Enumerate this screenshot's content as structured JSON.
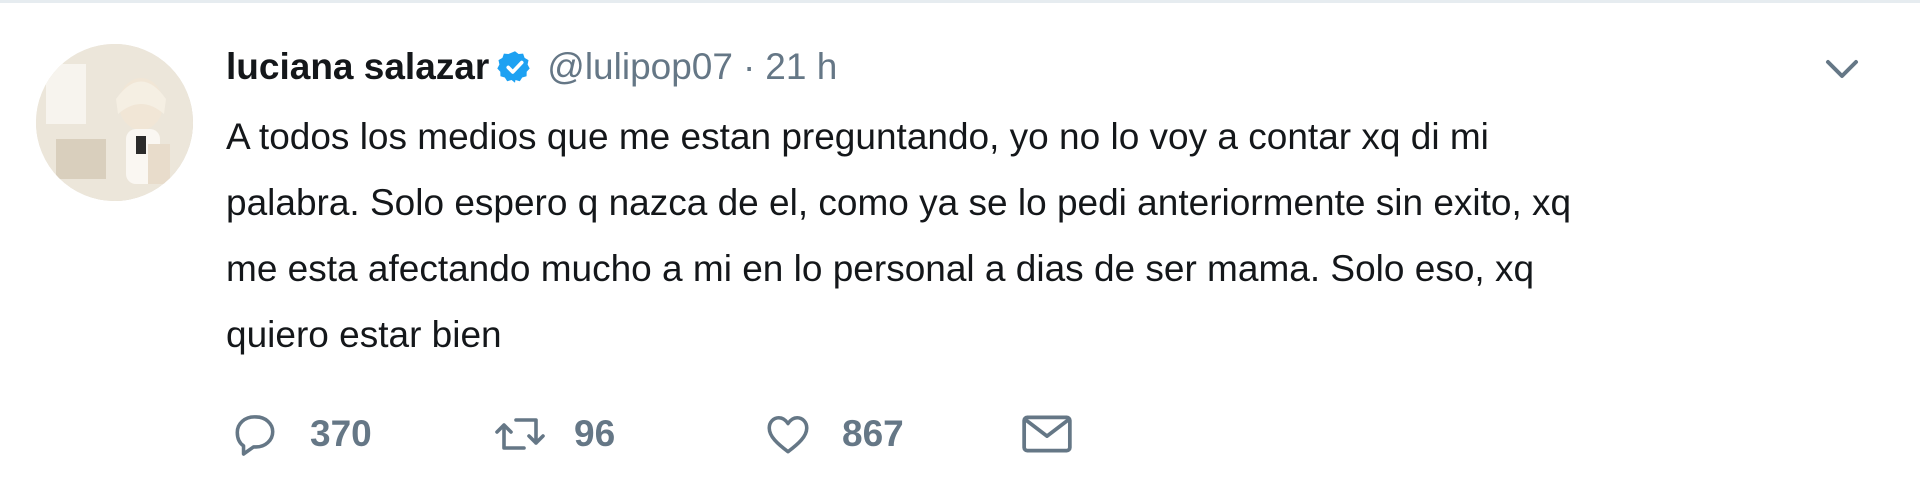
{
  "tweet": {
    "author_name": "luciana salazar",
    "handle": "@lulipop07",
    "separator": "·",
    "time": "21 h",
    "text_lines": [
      "A todos los medios que me estan preguntando, yo no lo voy a contar xq di mi",
      "palabra. Solo espero q nazca de el, como ya se lo pedi anteriormente sin exito, xq",
      "me esta afectando mucho a mi en lo personal a dias de ser mama. Solo eso, xq",
      "quiero estar bien"
    ],
    "icons": {
      "verified": "verified-badge-icon",
      "caret": "chevron-down-icon",
      "reply": "reply-icon",
      "retweet": "retweet-icon",
      "like": "heart-icon",
      "dm": "envelope-icon"
    }
  },
  "actions": {
    "reply_count": "370",
    "retweet_count": "96",
    "like_count": "867"
  },
  "colors": {
    "text": "#14171a",
    "secondary": "#657786",
    "verified": "#1da1f2",
    "border": "#e6ecf0"
  }
}
